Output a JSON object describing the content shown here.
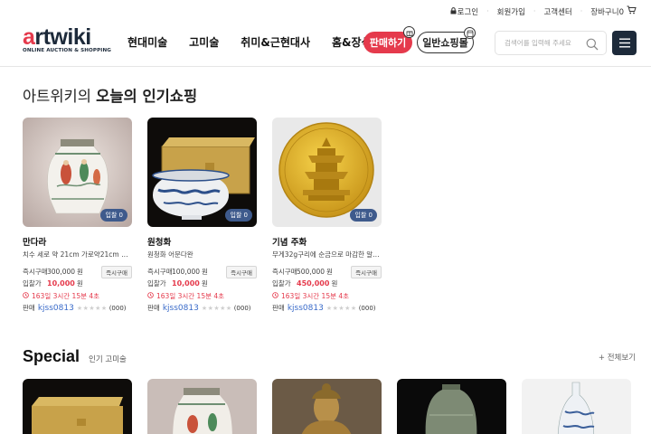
{
  "utility": {
    "login": "로그인",
    "join": "회원가입",
    "support": "고객센터",
    "cart": "장바구니0"
  },
  "logo": {
    "word_a": "a",
    "word_rest": "rtwiki",
    "sub": "ONLINE AUCTION & SHOPPING"
  },
  "gnb": [
    "현대미술",
    "고미술",
    "취미&근현대사",
    "홈&장식"
  ],
  "buttons": {
    "sell": "판매하기",
    "shop": "일반쇼핑몰"
  },
  "search": {
    "placeholder": "검색어를 입력해 주세요"
  },
  "section": {
    "prefix": "아트위키의 ",
    "emphasis": "오늘의 인기쇼핑"
  },
  "products": [
    {
      "bids": "입찰 0",
      "title": "만다라",
      "desc": "치수 세로 약 21cm 가로약21cm 높...",
      "buy_label": "즉시구매",
      "buy_price": "300,000",
      "buy_unit": "원",
      "buy_tag": "즉시구매",
      "bid_label": "입찰가",
      "bid_price": "10,000",
      "bid_unit": "원",
      "time": "163일 3시간 15분 4초",
      "seller_label": "판매",
      "seller": "kjss0813",
      "stars": "★★★★★",
      "reviews": "(000)"
    },
    {
      "bids": "입찰 0",
      "title": "원청화",
      "desc": "원청화 어문다완",
      "buy_label": "즉시구매",
      "buy_price": "100,000",
      "buy_unit": "원",
      "buy_tag": "즉시구매",
      "bid_label": "입찰가",
      "bid_price": "10,000",
      "bid_unit": "원",
      "time": "163일 3시간 15분 4초",
      "seller_label": "판매",
      "seller": "kjss0813",
      "stars": "★★★★★",
      "reviews": "(000)"
    },
    {
      "bids": "입찰 0",
      "title": "기념 주화",
      "desc": "무게32g구리에 순금으로 마감한 알품...",
      "buy_label": "즉시구매",
      "buy_price": "500,000",
      "buy_unit": "원",
      "buy_tag": "즉시구매",
      "bid_label": "입찰가",
      "bid_price": "450,000",
      "bid_unit": "원",
      "time": "163일 3시간 15분 4초",
      "seller_label": "판매",
      "seller": "kjss0813",
      "stars": "★★★★★",
      "reviews": "(000)"
    }
  ],
  "special": {
    "title": "Special",
    "subtitle": "인기 고미술",
    "view_all": "+ 전체보기"
  },
  "colors": {
    "accent": "#e53a4c",
    "navy": "#1d2a3a",
    "badge": "#3e5a8c",
    "link": "#3a6bc9"
  }
}
